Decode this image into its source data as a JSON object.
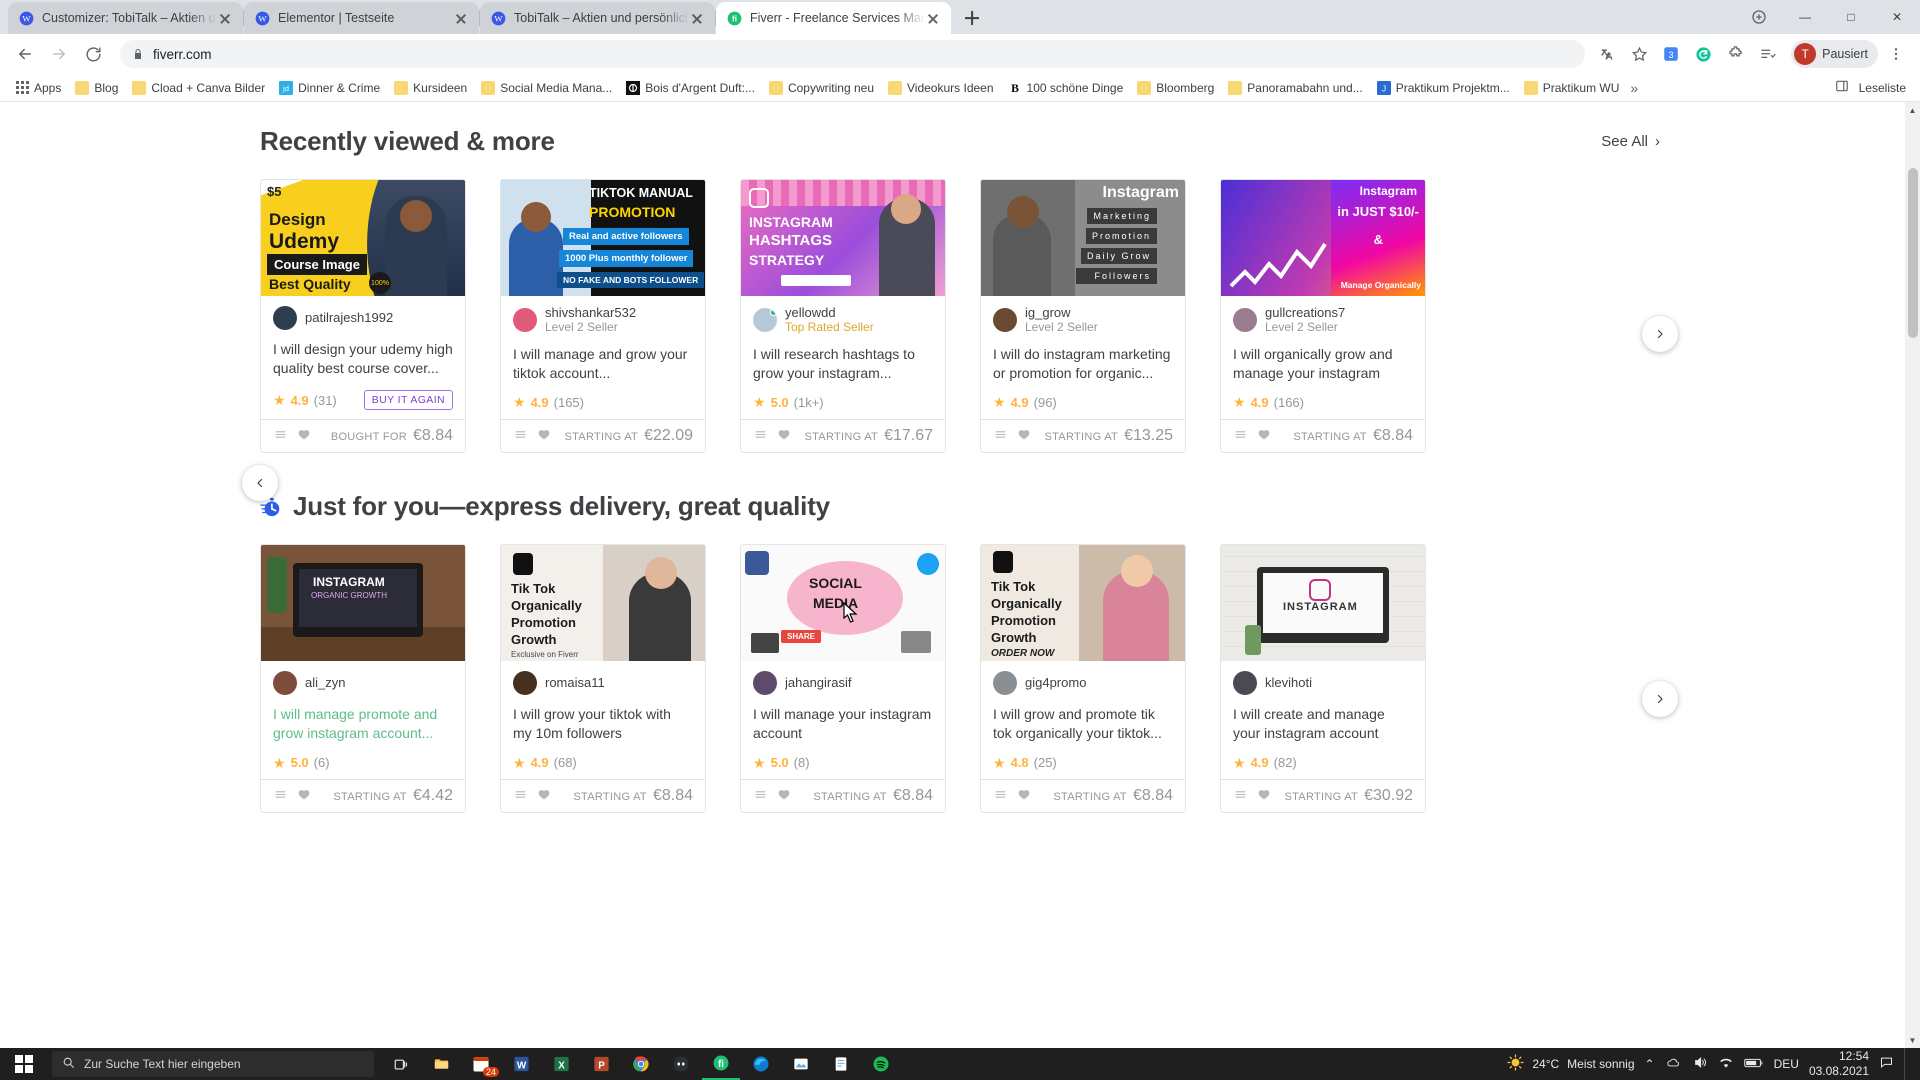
{
  "browser": {
    "tabs": [
      {
        "title": "Customizer: TobiTalk – Aktien un",
        "favicon": "wordpress-icon",
        "active": false
      },
      {
        "title": "Elementor | Testseite",
        "favicon": "wordpress-icon",
        "active": false
      },
      {
        "title": "TobiTalk – Aktien und persönlich",
        "favicon": "wordpress-icon",
        "active": false
      },
      {
        "title": "Fiverr - Freelance Services Marke",
        "favicon": "fiverr-icon",
        "active": true
      }
    ],
    "new_tab_label": "+",
    "window_controls": {
      "minimize": "—",
      "maximize": "□",
      "close": "✕"
    },
    "url": "fiverr.com",
    "nav": {
      "back": "←",
      "forward": "→",
      "reload": "⟳"
    },
    "profile": {
      "initial": "T",
      "name": "Pausiert"
    },
    "bookmarks": [
      {
        "label": "Apps",
        "icon": "apps-grid-icon"
      },
      {
        "label": "Blog",
        "icon": "folder-icon"
      },
      {
        "label": "Cload + Canva Bilder",
        "icon": "folder-icon"
      },
      {
        "label": "Dinner & Crime",
        "icon": "jd-icon"
      },
      {
        "label": "Kursideen",
        "icon": "folder-icon"
      },
      {
        "label": "Social Media Mana...",
        "icon": "folder-icon"
      },
      {
        "label": "Bois d'Argent Duft:...",
        "icon": "dark-circle-icon"
      },
      {
        "label": "Copywriting neu",
        "icon": "folder-icon"
      },
      {
        "label": "Videokurs Ideen",
        "icon": "folder-icon"
      },
      {
        "label": "100 schöne Dinge",
        "icon": "black-b-icon"
      },
      {
        "label": "Bloomberg",
        "icon": "folder-icon"
      },
      {
        "label": "Panoramabahn und...",
        "icon": "folder-icon"
      },
      {
        "label": "Praktikum Projektm...",
        "icon": "blue-j-icon"
      },
      {
        "label": "Praktikum WU",
        "icon": "folder-icon"
      }
    ],
    "bookmarks_overflow": "»",
    "reading_list": "Leseliste"
  },
  "sections": [
    {
      "title": "Recently viewed & more",
      "icon": null,
      "see_all": "See All",
      "see_all_chevron": "›",
      "has_left_arrow": false,
      "cards": [
        {
          "seller": "patilrajesh1992",
          "level": "",
          "title": "I will design your udemy high quality best course cover...",
          "rating": "4.9",
          "reviews": "(31)",
          "price_label": "BOUGHT FOR",
          "price": "€8.84",
          "badge": "BUY IT AGAIN",
          "thumb_overlay": "$5",
          "thumb_text": [
            "Design",
            "Udemy",
            "Course Image",
            "Best Quality"
          ],
          "visited": false
        },
        {
          "seller": "shivshankar532",
          "level": "Level 2 Seller",
          "title": "I will manage and grow your tiktok account...",
          "rating": "4.9",
          "reviews": "(165)",
          "price_label": "STARTING AT",
          "price": "€22.09",
          "badge": "",
          "thumb_overlay": "",
          "thumb_text": [
            "TIKTOK MANUAL",
            "PROMOTION",
            "Real and active followers",
            "1000 Plus monthly follower",
            "NO FAKE AND BOTS FOLLOWER"
          ],
          "visited": false
        },
        {
          "seller": "yellowdd",
          "level": "Top Rated Seller",
          "title": "I will research hashtags to grow your instagram...",
          "rating": "5.0",
          "reviews": "(1k+)",
          "price_label": "STARTING AT",
          "price": "€17.67",
          "badge": "",
          "thumb_overlay": "",
          "thumb_text": [
            "INSTAGRAM",
            "HASHTAGS",
            "STRATEGY"
          ],
          "visited": false
        },
        {
          "seller": "ig_grow",
          "level": "Level 2 Seller",
          "title": "I will do instagram marketing or promotion for organic...",
          "rating": "4.9",
          "reviews": "(96)",
          "price_label": "STARTING AT",
          "price": "€13.25",
          "badge": "",
          "thumb_overlay": "",
          "thumb_text": [
            "Instagram",
            "Marketing",
            "Promotion",
            "Daily Grow",
            "Followers"
          ],
          "visited": false
        },
        {
          "seller": "gullcreations7",
          "level": "Level 2 Seller",
          "title": "I will organically grow and manage your instagram",
          "rating": "4.9",
          "reviews": "(166)",
          "price_label": "STARTING AT",
          "price": "€8.84",
          "badge": "",
          "thumb_overlay": "",
          "thumb_text": [
            "Instagram",
            "in JUST $10/-",
            "&",
            "Manage Organically"
          ],
          "visited": false
        }
      ]
    },
    {
      "title": "Just for you—express delivery, great quality",
      "icon": "stopwatch-icon",
      "see_all": "",
      "see_all_chevron": "",
      "has_left_arrow": true,
      "cards": [
        {
          "seller": "ali_zyn",
          "level": "",
          "title": "I will manage promote and grow instagram account...",
          "rating": "5.0",
          "reviews": "(6)",
          "price_label": "STARTING AT",
          "price": "€4.42",
          "badge": "",
          "thumb_overlay": "",
          "thumb_text": [
            "INSTAGRAM",
            "ORGANIC GROWTH"
          ],
          "visited": true
        },
        {
          "seller": "romaisa11",
          "level": "",
          "title": "I will grow your tiktok with my 10m followers",
          "rating": "4.9",
          "reviews": "(68)",
          "price_label": "STARTING AT",
          "price": "€8.84",
          "badge": "",
          "thumb_overlay": "",
          "thumb_text": [
            "Tik Tok",
            "Organically",
            "Promotion",
            "Growth",
            "Exclusive on Fiverr"
          ],
          "visited": false
        },
        {
          "seller": "jahangirasif",
          "level": "",
          "title": "I will manage your instagram account",
          "rating": "5.0",
          "reviews": "(8)",
          "price_label": "STARTING AT",
          "price": "€8.84",
          "badge": "",
          "thumb_overlay": "",
          "thumb_text": [
            "SOCIAL",
            "MEDIA",
            "SHARE"
          ],
          "visited": false
        },
        {
          "seller": "gig4promo",
          "level": "",
          "title": "I will grow and promote tik tok organically your tiktok...",
          "rating": "4.8",
          "reviews": "(25)",
          "price_label": "STARTING AT",
          "price": "€8.84",
          "badge": "",
          "thumb_overlay": "",
          "thumb_text": [
            "Tik Tok",
            "Organically",
            "Promotion",
            "Growth",
            "ORDER NOW"
          ],
          "visited": false
        },
        {
          "seller": "klevihoti",
          "level": "",
          "title": "I will create and manage your instagram account",
          "rating": "4.9",
          "reviews": "(82)",
          "price_label": "STARTING AT",
          "price": "€30.92",
          "badge": "",
          "thumb_overlay": "",
          "thumb_text": [
            "INSTAGRAM"
          ],
          "visited": false
        }
      ]
    }
  ],
  "taskbar": {
    "search_placeholder": "Zur Suche Text hier eingeben",
    "apps": [
      {
        "name": "task-view-icon"
      },
      {
        "name": "file-explorer-icon"
      },
      {
        "name": "calendar-icon",
        "badge": "24"
      },
      {
        "name": "word-icon"
      },
      {
        "name": "excel-icon"
      },
      {
        "name": "powerpoint-icon"
      },
      {
        "name": "chrome-icon"
      },
      {
        "name": "discord-icon"
      },
      {
        "name": "fiverr-icon"
      },
      {
        "name": "edge-icon"
      },
      {
        "name": "photos-icon"
      },
      {
        "name": "notepad-icon"
      },
      {
        "name": "spotify-icon"
      }
    ],
    "weather_temp": "24°C",
    "weather_desc": "Meist sonnig",
    "language": "DEU",
    "time": "12:54",
    "date": "03.08.2021",
    "tray_chevron": "⌃"
  },
  "colors": {
    "fiverr_green": "#1dbf73",
    "rating_gold": "#ffb33e",
    "visited_green": "#5bbd8a",
    "badge_purple": "#7b3fd4",
    "text_dark": "#404145",
    "text_muted": "#95979d"
  }
}
